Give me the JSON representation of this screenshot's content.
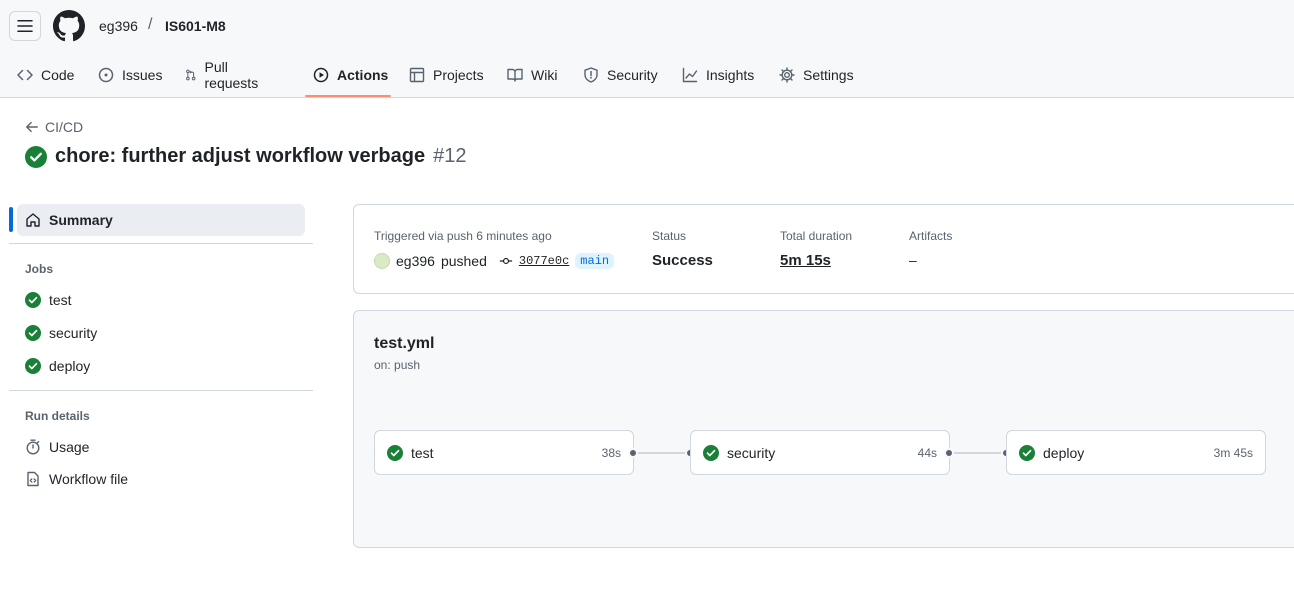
{
  "header": {
    "owner": "eg396",
    "separator": "/",
    "repo": "IS601-M8"
  },
  "nav": [
    {
      "label": "Code",
      "icon": "code-icon"
    },
    {
      "label": "Issues",
      "icon": "issue-icon"
    },
    {
      "label": "Pull requests",
      "icon": "pull-request-icon"
    },
    {
      "label": "Actions",
      "icon": "play-icon",
      "active": true
    },
    {
      "label": "Projects",
      "icon": "table-icon"
    },
    {
      "label": "Wiki",
      "icon": "book-icon"
    },
    {
      "label": "Security",
      "icon": "shield-icon"
    },
    {
      "label": "Insights",
      "icon": "graph-icon"
    },
    {
      "label": "Settings",
      "icon": "gear-icon"
    }
  ],
  "run": {
    "back_label": "CI/CD",
    "title": "chore: further adjust workflow verbage",
    "number": "#12"
  },
  "sidebar": {
    "summary_label": "Summary",
    "jobs_heading": "Jobs",
    "jobs": [
      "test",
      "security",
      "deploy"
    ],
    "run_details_heading": "Run details",
    "usage_label": "Usage",
    "workflow_file_label": "Workflow file"
  },
  "summary": {
    "triggered_label": "Triggered via push 6 minutes ago",
    "actor": "eg396",
    "action": "pushed",
    "sha": "3077e0c",
    "branch": "main",
    "status_label": "Status",
    "status_value": "Success",
    "duration_label": "Total duration",
    "duration_value": "5m 15s",
    "artifacts_label": "Artifacts",
    "artifacts_value": "–"
  },
  "workflow": {
    "file": "test.yml",
    "trigger": "on: push",
    "jobs": [
      {
        "name": "test",
        "duration": "38s"
      },
      {
        "name": "security",
        "duration": "44s"
      },
      {
        "name": "deploy",
        "duration": "3m 45s"
      }
    ]
  },
  "colors": {
    "success": "#1a7f37",
    "accent": "#0969da",
    "nav_underline": "#fd8c73"
  }
}
